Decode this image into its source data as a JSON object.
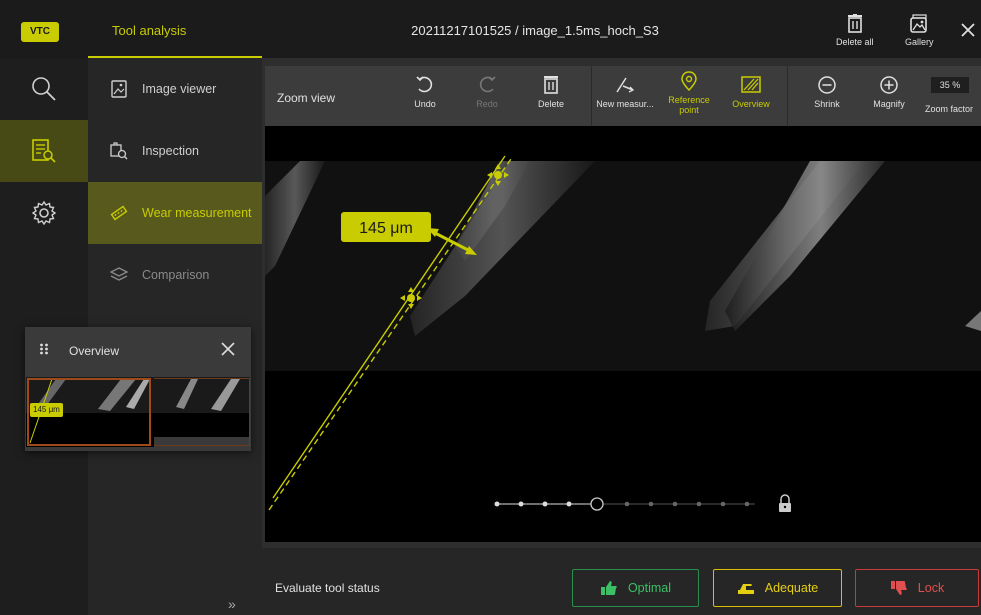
{
  "header": {
    "logo_text": "VTC",
    "app_title": "Tool analysis",
    "file_title": "20211217101525 / image_1.5ms_hoch_S3",
    "delete_all_label": "Delete all",
    "gallery_label": "Gallery"
  },
  "rail": {
    "items": [
      {
        "icon": "search-icon",
        "active": false
      },
      {
        "icon": "analysis-icon",
        "active": true
      },
      {
        "icon": "settings-icon",
        "active": false
      }
    ]
  },
  "subnav": {
    "items": [
      {
        "label": "Image viewer",
        "icon": "image-file-icon",
        "state": "normal"
      },
      {
        "label": "Inspection",
        "icon": "inspection-icon",
        "state": "normal"
      },
      {
        "label": "Wear measurement",
        "icon": "wear-measurement-icon",
        "state": "active"
      },
      {
        "label": "Comparison",
        "icon": "layers-icon",
        "state": "disabled"
      }
    ],
    "expand_glyph": "»"
  },
  "toolbar": {
    "zoom_view_label": "Zoom view",
    "undo_label": "Undo",
    "redo_label": "Redo",
    "delete_label": "Delete",
    "new_measurement_label": "New measur...",
    "reference_point_label": "Reference point",
    "overview_label": "Overview",
    "shrink_label": "Shrink",
    "magnify_label": "Magnify",
    "zoom_factor_label": "Zoom factor",
    "zoom_value": "35 %"
  },
  "measurement": {
    "label": "145 μm"
  },
  "overview": {
    "title": "Overview",
    "thumb_label": "145 μm"
  },
  "status": {
    "evaluate_label": "Evaluate tool status",
    "optimal_label": "Optimal",
    "adequate_label": "Adequate",
    "lock_label": "Lock"
  },
  "colors": {
    "accent": "#c8cc00",
    "optimal": "#3cbf65",
    "adequate": "#e6cf10",
    "lock": "#e05050"
  }
}
